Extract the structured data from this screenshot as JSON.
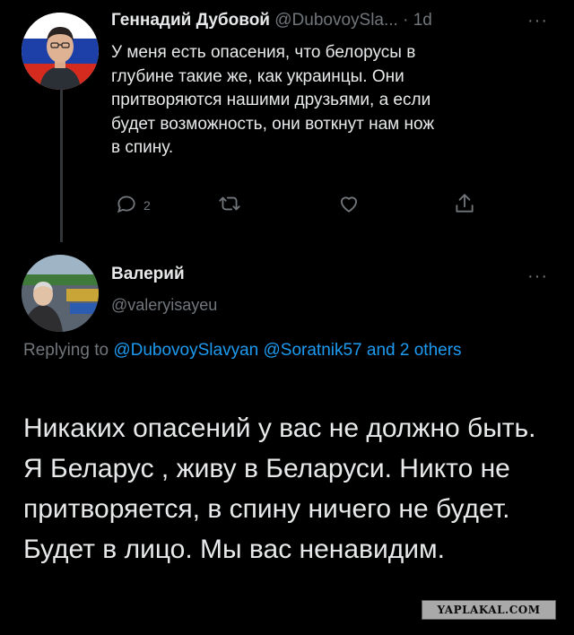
{
  "tweet1": {
    "display_name": "Геннадий Дубовой",
    "handle": "@DubovoySla...",
    "time": "· 1d",
    "more": "···",
    "text": "У меня есть опасения, что белорусы в\nглубине такие же, как украинцы. Они\nпритворяются нашими друзьями, а если\nбудет возможность, они воткнут нам нож\nв спину.",
    "actions": {
      "reply_count": "2",
      "reply_icon": "comment-icon",
      "retweet_icon": "retweet-icon",
      "like_icon": "heart-icon",
      "share_icon": "share-icon"
    }
  },
  "tweet2": {
    "display_name": "Валерий",
    "handle": "@valeryisayeu",
    "more": "···",
    "replying_prefix": "Replying to ",
    "mention1": "@DubovoySlavyan",
    "mention2": "@Soratnik57",
    "and_others": "and 2 others",
    "text": "Никаких опасений у вас не должно быть. Я Беларус , живу в Беларуси. Никто не притворяется, в спину ничего не будет. Будет в лицо. Мы вас ненавидим."
  },
  "watermark": "YAPLAKAL.COM",
  "colors": {
    "background": "#000000",
    "text": "#e7e9ea",
    "muted": "#71767b",
    "link": "#1d9bf0"
  }
}
